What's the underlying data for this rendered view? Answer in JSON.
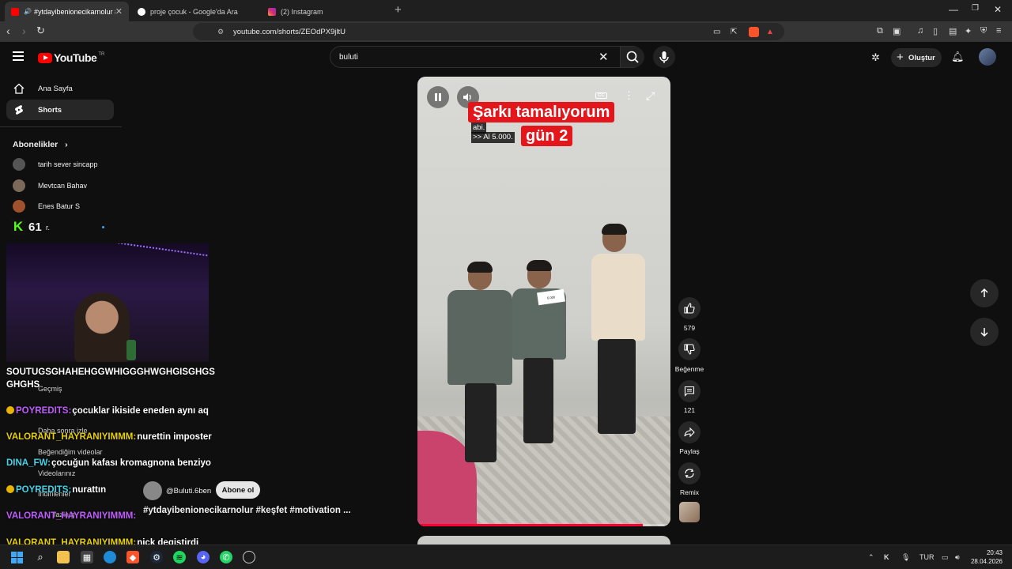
{
  "browser": {
    "tabs": [
      {
        "title": "#ytdayibenionecikarnolur #ke",
        "active": true,
        "favicon": "youtube-icon"
      },
      {
        "title": "proje çocuk - Google'da Ara",
        "active": false,
        "favicon": "google-icon"
      },
      {
        "title": "(2) Instagram",
        "active": false,
        "favicon": "instagram-icon"
      }
    ],
    "url": "youtube.com/shorts/ZEOdPX9jltU"
  },
  "youtube": {
    "logo_text": "YouTube",
    "country_code": "TR",
    "search_value": "buluti",
    "create_label": "Oluştur",
    "sidebar": {
      "home": "Ana Sayfa",
      "shorts": "Shorts",
      "subscriptions_title": "Abonelikler",
      "subscriptions": [
        "tarih sever sincapp",
        "Mevtcan Bahav",
        "Enes Batur S"
      ],
      "partial_sub": "r.",
      "history": "Geçmiş",
      "watch_later": "Daha sonra izle",
      "liked": "Beğendiğim videolar",
      "your_videos": "Videolarınız",
      "downloads": "İndirilenler",
      "more_partial": "fazla g"
    },
    "short": {
      "caption_line1": "Şarkı tamalıyorum",
      "caption_line2": "gün 2",
      "subtitle_line1": "abi.",
      "subtitle_line2": ">> Al 5.000.",
      "note_text": "5.000",
      "channel": "@Buluti.6ben",
      "subscribe": "Abone ol",
      "hashtags": "#ytdayibenionecikarnolur #keşfet #motivation ...",
      "progress": 0.89,
      "likes": "579",
      "dislike_label": "Beğenme",
      "comments": "121",
      "share_label": "Paylaş",
      "remix_label": "Remix"
    }
  },
  "stream_overlay": {
    "viewer_count": "61",
    "chat": [
      {
        "user": "",
        "text": "SOUTUGSGHAHEHGGWHIGGGHWGHGISGHGS",
        "user_color": "#ffffff",
        "badge": false
      },
      {
        "user": "",
        "text": "GHGHS",
        "user_color": "#ffffff",
        "badge": false
      },
      {
        "user": "POYREDITS:",
        "text": "çocuklar ikiside eneden aynı aq",
        "user_color": "#c05cff",
        "badge": true
      },
      {
        "user": "VALORANT_HAYRANIYIMMM:",
        "text": "nurettin imposter",
        "user_color": "#e8d000",
        "badge": false
      },
      {
        "user": "DINA_FW:",
        "text": "çocuğun kafası kromagnona benziyo",
        "user_color": "#43d3e8",
        "badge": false
      },
      {
        "user": "POYREDITS:",
        "text": "nurattın",
        "user_color": "#43d3e8",
        "badge": true
      },
      {
        "user": "VALORANT_HAYRANIYIMMM:",
        "text": "",
        "user_color": "#c05cff",
        "badge": false
      },
      {
        "user": "VALORANT_HAYRANIYIMMM:",
        "text": "nick degistirdi",
        "user_color": "#e8d000",
        "badge": false
      }
    ]
  },
  "taskbar": {
    "language": "TUR",
    "time": "20:43",
    "date": "28.04.2026"
  }
}
